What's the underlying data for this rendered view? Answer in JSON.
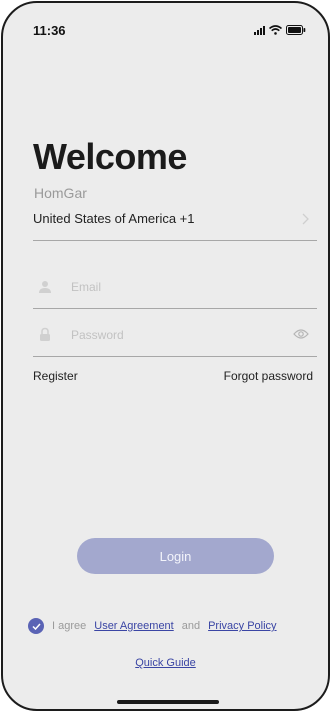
{
  "status_bar": {
    "time": "11:36"
  },
  "header": {
    "title": "Welcome",
    "subtitle": "HomGar"
  },
  "country": {
    "value": "United States of America +1"
  },
  "email": {
    "placeholder": "Email"
  },
  "password": {
    "placeholder": "Password"
  },
  "links": {
    "register": "Register",
    "forgot_password": "Forgot password"
  },
  "login": {
    "label": "Login"
  },
  "agreement": {
    "prefix": "I agree",
    "user_agreement": "User Agreement",
    "and": "and",
    "privacy_policy": "Privacy Policy",
    "checked": true
  },
  "quick_guide": {
    "label": "Quick Guide"
  },
  "colors": {
    "accent": "#5a63b5",
    "button": "#a3a8ce",
    "link": "#3a45a4",
    "background": "#ececec"
  },
  "icons": {
    "signal": "signal-icon",
    "wifi": "wifi-icon",
    "battery": "battery-icon",
    "chevron": "chevron-right-icon",
    "user": "user-icon",
    "lock": "lock-icon",
    "eye": "eye-icon",
    "check": "check-icon"
  }
}
